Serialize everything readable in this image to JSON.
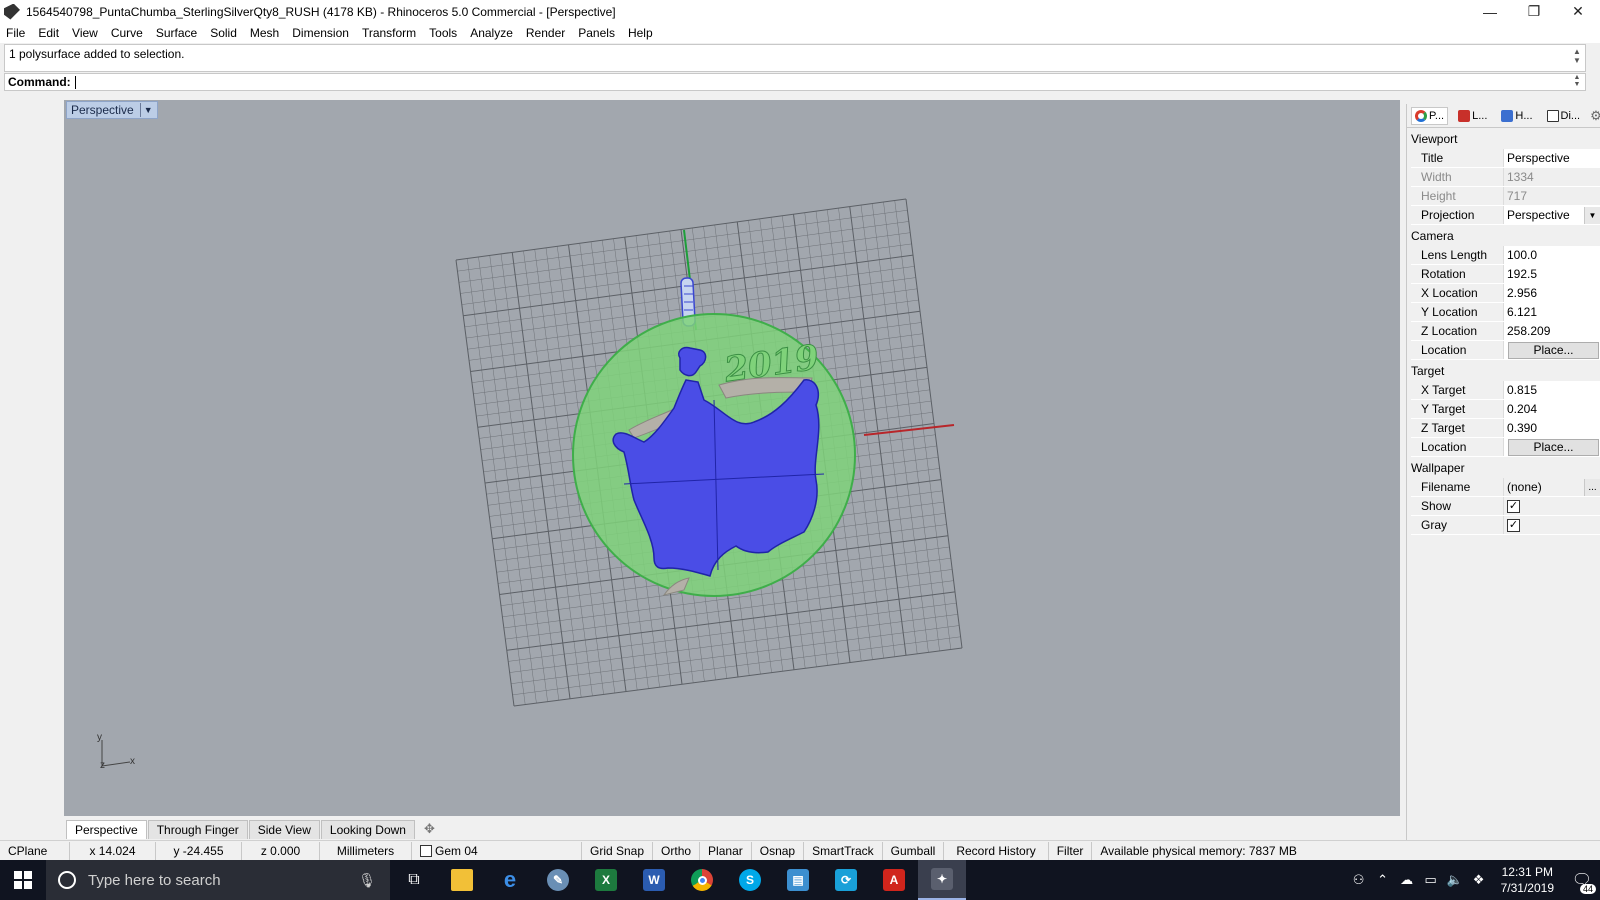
{
  "window": {
    "title": "1564540798_PuntaChumba_SterlingSilverQty8_RUSH (4178 KB) - Rhinoceros 5.0 Commercial - [Perspective]",
    "controls": [
      "—",
      "❐",
      "✕"
    ]
  },
  "menu": [
    "File",
    "Edit",
    "View",
    "Curve",
    "Surface",
    "Solid",
    "Mesh",
    "Dimension",
    "Transform",
    "Tools",
    "Analyze",
    "Render",
    "Panels",
    "Help"
  ],
  "command_history": "1 polysurface added to selection.",
  "command": {
    "label": "Command:",
    "value": ""
  },
  "viewport": {
    "title": "Perspective",
    "text_2019": "2019",
    "axis_y": "y",
    "axis_z": "z",
    "axis_x": "x",
    "colors": {
      "background": "#a2a7ae",
      "disc": "#7fd27a",
      "figure": "#4a4de6",
      "grid": "#6e7278"
    }
  },
  "view_tabs": [
    "Perspective",
    "Through Finger",
    "Side View",
    "Looking Down"
  ],
  "status": {
    "cplane": "CPlane",
    "x": "x 14.024",
    "y": "y -24.455",
    "z": "z 0.000",
    "units": "Millimeters",
    "layer": "Gem 04",
    "toggles": [
      "Grid Snap",
      "Ortho",
      "Planar",
      "Osnap",
      "SmartTrack",
      "Gumball",
      "Record History",
      "Filter"
    ],
    "memory": "Available physical memory: 7837 MB"
  },
  "panel": {
    "tabs": [
      {
        "label": "P...",
        "icon": "properties-icon"
      },
      {
        "label": "L...",
        "icon": "layers-icon"
      },
      {
        "label": "H...",
        "icon": "help-icon"
      },
      {
        "label": "Di...",
        "icon": "display-icon"
      }
    ],
    "viewport_section": "Viewport",
    "title_label": "Title",
    "title_value": "Perspective",
    "width_label": "Width",
    "width_value": "1334",
    "height_label": "Height",
    "height_value": "717",
    "projection_label": "Projection",
    "projection_value": "Perspective",
    "camera_section": "Camera",
    "lens_label": "Lens Length",
    "lens_value": "100.0",
    "rotation_label": "Rotation",
    "rotation_value": "192.5",
    "xloc_label": "X Location",
    "xloc_value": "2.956",
    "yloc_label": "Y Location",
    "yloc_value": "6.121",
    "zloc_label": "Z Location",
    "zloc_value": "258.209",
    "cam_location_label": "Location",
    "place_label": "Place...",
    "target_section": "Target",
    "xt_label": "X Target",
    "xt_value": "0.815",
    "yt_label": "Y Target",
    "yt_value": "0.204",
    "zt_label": "Z Target",
    "zt_value": "0.390",
    "tgt_location_label": "Location",
    "wallpaper_section": "Wallpaper",
    "filename_label": "Filename",
    "filename_value": "(none)",
    "browse_label": "...",
    "show_label": "Show",
    "show_checked": "✓",
    "gray_label": "Gray",
    "gray_checked": "✓"
  },
  "taskbar": {
    "search_placeholder": "Type here to search",
    "apps": [
      {
        "name": "task-view",
        "glyph": "⧉",
        "color": "#101420"
      },
      {
        "name": "file-explorer",
        "glyph": "",
        "color": "#f2c037"
      },
      {
        "name": "edge",
        "glyph": "e",
        "color": "#1f7ad6"
      },
      {
        "name": "paint",
        "glyph": "✎",
        "color": "#6a8fb5"
      },
      {
        "name": "excel",
        "glyph": "X",
        "color": "#1d7a3e"
      },
      {
        "name": "word",
        "glyph": "W",
        "color": "#2b5cb0"
      },
      {
        "name": "chrome",
        "glyph": "",
        "color": "#db4437"
      },
      {
        "name": "skype",
        "glyph": "S",
        "color": "#00a8e8"
      },
      {
        "name": "monitor",
        "glyph": "▤",
        "color": "#3c8fd0"
      },
      {
        "name": "sync",
        "glyph": "⟳",
        "color": "#19a0d8"
      },
      {
        "name": "acrobat",
        "glyph": "A",
        "color": "#d0251c"
      },
      {
        "name": "rhino",
        "glyph": "✦",
        "color": "#5a5f6e"
      }
    ],
    "time": "12:31 PM",
    "date": "7/31/2019",
    "notifications": "44"
  }
}
